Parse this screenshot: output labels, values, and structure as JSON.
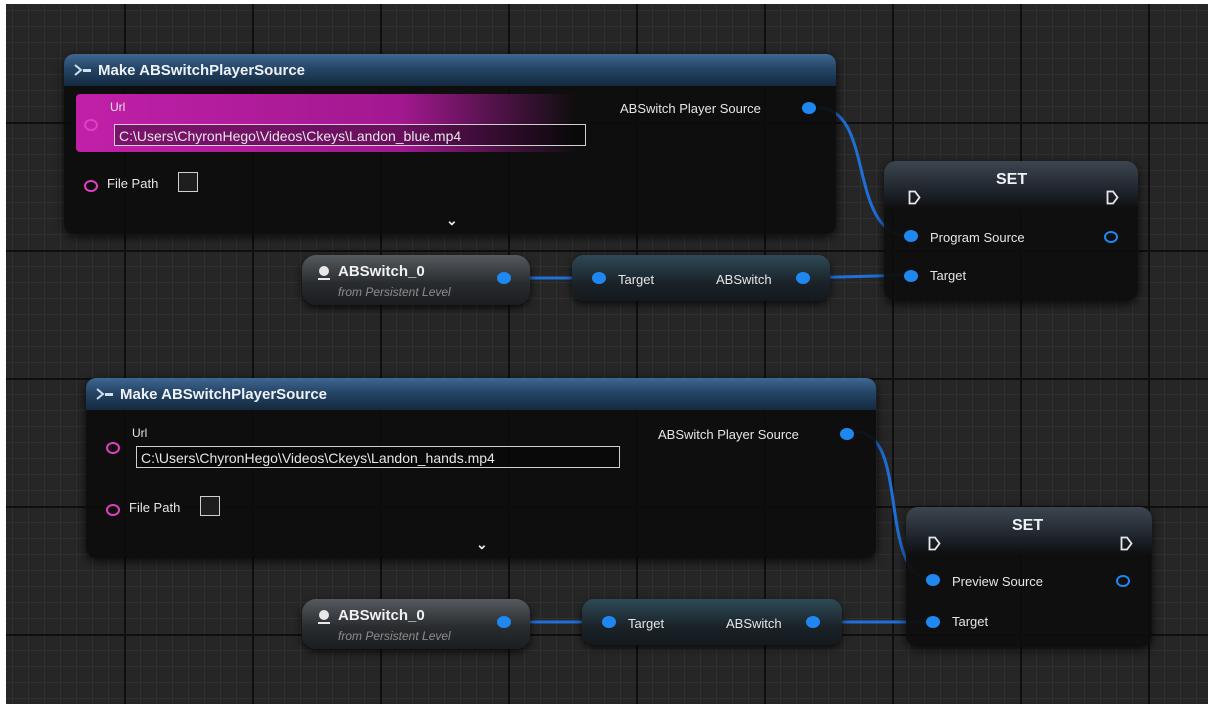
{
  "make_nodes": [
    {
      "title": "Make ABSwitchPlayerSource",
      "url_label": "Url",
      "url_value": "C:\\Users\\ChyronHego\\Videos\\Ckeys\\Landon_blue.mp4",
      "file_path_label": "File Path",
      "output_label": "ABSwitch Player Source"
    },
    {
      "title": "Make ABSwitchPlayerSource",
      "url_label": "Url",
      "url_value": "C:\\Users\\ChyronHego\\Videos\\Ckeys\\Landon_hands.mp4",
      "file_path_label": "File Path",
      "output_label": "ABSwitch Player Source"
    }
  ],
  "ref_nodes": [
    {
      "name": "ABSwitch_0",
      "subtitle": "from Persistent Level"
    },
    {
      "name": "ABSwitch_0",
      "subtitle": "from Persistent Level"
    }
  ],
  "func_nodes": [
    {
      "input_label": "Target",
      "output_label": "ABSwitch"
    },
    {
      "input_label": "Target",
      "output_label": "ABSwitch"
    }
  ],
  "set_nodes": [
    {
      "title": "SET",
      "value_label": "Program Source",
      "target_label": "Target"
    },
    {
      "title": "SET",
      "value_label": "Preview Source",
      "target_label": "Target"
    }
  ],
  "colors": {
    "struct_pin": "#1e88f0",
    "string_pin": "#e040c0",
    "url_highlight": "#c020a8",
    "wire": "#1e6fd8"
  },
  "icons": {
    "struct": "struct-icon",
    "exec": "exec-pin-icon",
    "actor": "actor-icon",
    "expand": "chevron-down-icon"
  }
}
